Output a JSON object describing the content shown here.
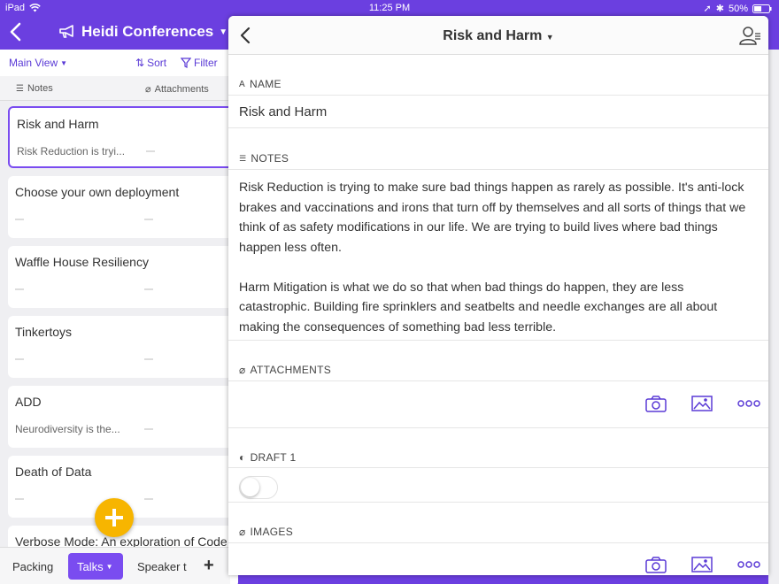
{
  "status_bar": {
    "device": "iPad",
    "time": "11:25 PM",
    "battery": "50%"
  },
  "app_header": {
    "title": "Heidi Conferences"
  },
  "list_toolbar": {
    "view_label": "Main View",
    "sort_label": "Sort",
    "filter_label": "Filter"
  },
  "column_headers": {
    "notes": "Notes",
    "attachments": "Attachments"
  },
  "records": [
    {
      "title": "Risk and Harm",
      "notes": "Risk Reduction is tryi...",
      "selected": true
    },
    {
      "title": "Choose your own deployment",
      "notes": ""
    },
    {
      "title": "Waffle House Resiliency",
      "notes": ""
    },
    {
      "title": "Tinkertoys",
      "notes": ""
    },
    {
      "title": "ADD",
      "notes": "Neurodiversity is the..."
    },
    {
      "title": "Death of Data",
      "notes": ""
    },
    {
      "title": "Verbose Mode: An exploration of Code",
      "notes": ""
    }
  ],
  "bottom_tabs": {
    "tab1": "Packing",
    "tab2": "Talks",
    "tab3": "Speaker t"
  },
  "detail": {
    "title": "Risk and Harm",
    "name_label": "NAME",
    "name_value": "Risk and Harm",
    "notes_label": "NOTES",
    "notes_p1": "Risk Reduction is trying to make sure bad things happen as rarely as possible. It's anti-lock brakes and vaccinations and irons that turn off by themselves and all sorts of things that we think of as safety modifications in our life. We are trying to build lives where bad things happen less often.",
    "notes_p2": "Harm Mitigation is what we do so that when bad things do happen, they are less catastrophic. Building fire sprinklers and seatbelts and needle exchanges are all about making the consequences of something bad less terrible.",
    "attachments_label": "ATTACHMENTS",
    "draft_label": "DRAFT 1",
    "draft_on": false,
    "images_label": "IMAGES"
  },
  "colors": {
    "accent": "#6b3fe0",
    "fab": "#f7b500",
    "icon": "#5a3ad6"
  }
}
